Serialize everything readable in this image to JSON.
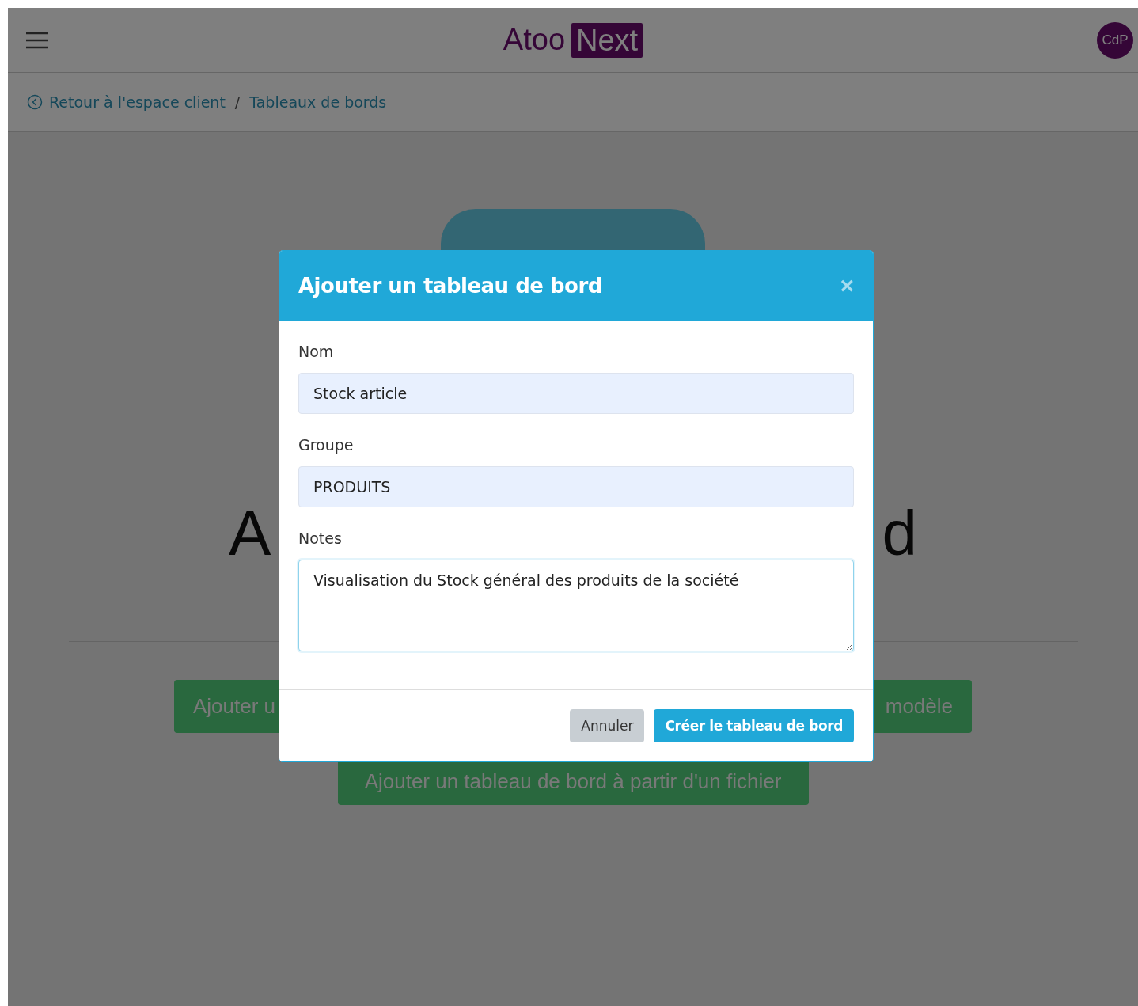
{
  "header": {
    "logo": {
      "text": "Atoo",
      "badge": "Next"
    },
    "avatar": "CdP"
  },
  "breadcrumb": {
    "back": "Retour à l'espace client",
    "separator": "/",
    "current": "Tableaux de bords"
  },
  "background": {
    "heading_fragments": [
      "A",
      "d"
    ],
    "buttons": [
      "Ajouter u",
      "modèle"
    ],
    "file_button": "Ajouter un tableau de bord à partir d'un fichier"
  },
  "modal": {
    "title": "Ajouter un tableau de bord",
    "close": "×",
    "fields": [
      {
        "kind": "input",
        "label": "Nom",
        "value": "Stock article"
      },
      {
        "kind": "input",
        "label": "Groupe",
        "value": "PRODUITS"
      },
      {
        "kind": "textarea",
        "label": "Notes",
        "value": "Visualisation du Stock général des produits de la société"
      }
    ],
    "buttons": [
      {
        "label": "Annuler",
        "kind": "secondary"
      },
      {
        "label": "Créer le tableau de bord",
        "kind": "primary"
      }
    ]
  }
}
